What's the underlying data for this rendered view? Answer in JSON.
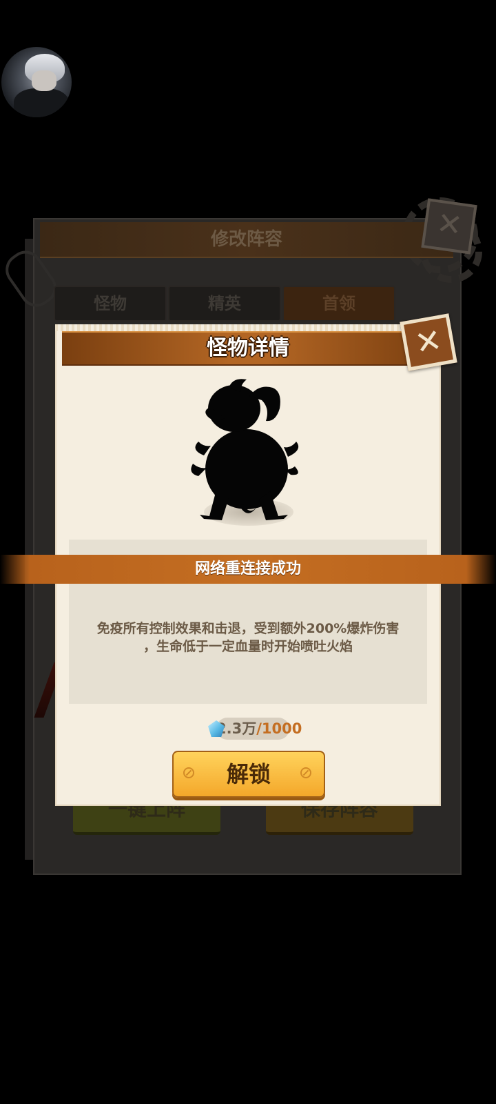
{
  "back_panel": {
    "title": "修改阵容",
    "tabs": [
      "怪物",
      "精英",
      "首领"
    ],
    "active_tab_index": 2,
    "buttons": {
      "left": "一键上阵",
      "right": "保存阵容"
    }
  },
  "dialog": {
    "title": "怪物详情",
    "description_line1": "免疫所有控制效果和击退，受到额外200%爆炸伤害",
    "description_line2": "，生命低于一定血量时开始喷吐火焰",
    "cost": {
      "have": "2.3万",
      "need": "/1000",
      "icon": "gem-icon"
    },
    "unlock_label": "解锁"
  },
  "toast": {
    "text": "网络重连接成功"
  },
  "colors": {
    "dialog_bg": "#f5eee0",
    "title_bar": "#b36624",
    "toast": "#c46e22",
    "unlock_button": "#f4a72a"
  }
}
